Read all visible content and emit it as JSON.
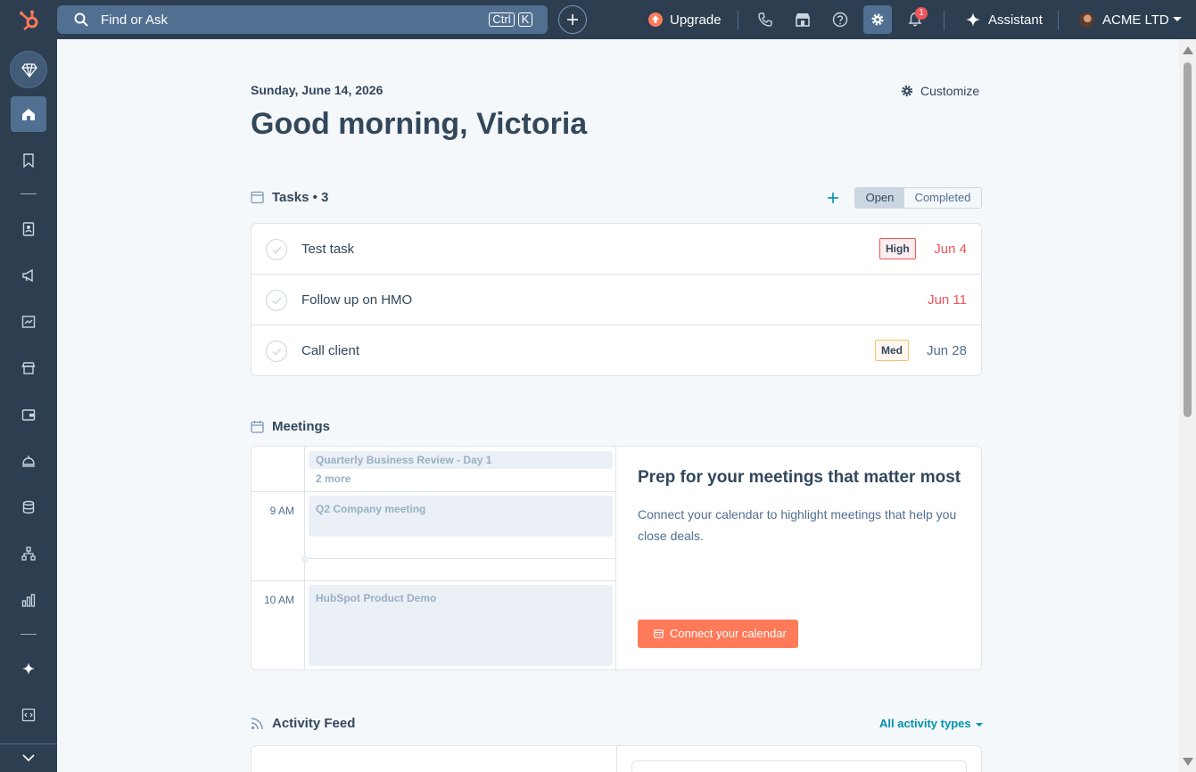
{
  "topbar": {
    "search_placeholder": "Find or Ask",
    "kbd_ctrl": "Ctrl",
    "kbd_k": "K",
    "upgrade_label": "Upgrade",
    "notification_count": "1",
    "assistant_label": "Assistant",
    "account_name": "ACME LTD"
  },
  "header": {
    "date": "Sunday, June 14, 2026",
    "greeting": "Good morning, Victoria",
    "customize_label": "Customize"
  },
  "tasks": {
    "title": "Tasks • 3",
    "filter_open": "Open",
    "filter_completed": "Completed",
    "items": [
      {
        "name": "Test task",
        "priority": "High",
        "due": "Jun 4"
      },
      {
        "name": "Follow up on HMO",
        "priority": "",
        "due": "Jun 11"
      },
      {
        "name": "Call client",
        "priority": "Med",
        "due": "Jun 28"
      }
    ]
  },
  "meetings": {
    "title": "Meetings",
    "allday_event": "Quarterly Business Review - Day 1",
    "more_label": "2 more",
    "time_9": "9 AM",
    "time_10": "10 AM",
    "event_9": "Q2 Company meeting",
    "event_10": "HubSpot Product Demo",
    "prep_title": "Prep for your meetings that matter most",
    "prep_body": "Connect your calendar to highlight meetings that help you close deals.",
    "connect_label": "Connect your calendar"
  },
  "activity": {
    "title": "Activity Feed",
    "filter_label": "All activity types"
  },
  "colors": {
    "nav_bg": "#2d3e50",
    "accent_orange": "#ff7a59",
    "link_teal": "#0091ae",
    "alert_red": "#f2545b"
  }
}
